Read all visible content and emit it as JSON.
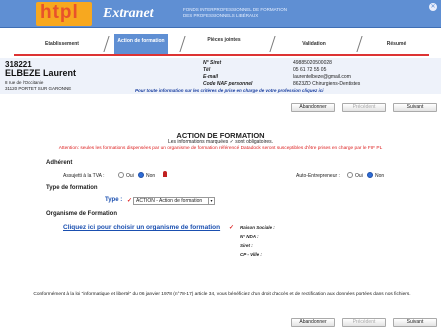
{
  "header": {
    "logo": "htpl",
    "brand": "Extranet",
    "tagline_1": "FONDS INTERPROFESSIONNEL DE FORMATION",
    "tagline_2": "DES PROFESSIONNELS LIBÉRAUX"
  },
  "steps": [
    {
      "label": "Etablissement"
    },
    {
      "label": "Action de formation",
      "active": true
    },
    {
      "label": "Pièces jointes"
    },
    {
      "label": "Validation"
    },
    {
      "label": "Résumé"
    }
  ],
  "establishment": {
    "id": "318221",
    "name": "ELBEZE Laurent",
    "address_1": "8 rue de l'Occitanie",
    "address_2": "31120 PORTET SUR GARONNE",
    "fields": [
      {
        "label": "N° Siret",
        "value": "49885020500028"
      },
      {
        "label": "Tél",
        "value": "05 61 72 55 05"
      },
      {
        "label": "E-mail",
        "value": "laurentelbeze@gmail.com"
      },
      {
        "label": "Code NAF personnel",
        "value": "8623ZD Chirurgiens-Dentistes"
      }
    ],
    "note": "Pour toute information sur les critères de prise en charge de votre profession cliquez ici"
  },
  "nav": {
    "abandon": "Abandonner",
    "previous": "Précédent",
    "next": "Suivant"
  },
  "section": {
    "title": "ACTION DE FORMATION",
    "subtitle": "Les informations marquées ✓ sont obligatoires.",
    "warning": "Attention: seules les formations dispensées par un organisme de formation référencé Datadock seront susceptibles d'être prises en charge par le FIF PL"
  },
  "adherent": {
    "heading": "Adhérent",
    "tva_label": "Assujetti à la TVA :",
    "tva_options": [
      "Oui",
      "Non"
    ],
    "tva_selected": "Non",
    "auto_label": "Auto-Entrepreneur :",
    "auto_options": [
      "Oui",
      "Non"
    ],
    "auto_selected": "Non"
  },
  "type": {
    "heading": "Type de formation",
    "label": "Type :",
    "selected": "ACTION - Action de formation"
  },
  "organisme": {
    "heading": "Organisme de Formation",
    "link": "Cliquez ici pour choisir un organisme de formation",
    "raison": "Raison Sociale :",
    "nda": "N° NDA :",
    "siret": "Siret :",
    "cp": "CP - Ville :"
  },
  "footer": {
    "text": "Conformément à la loi \"informatique et liberté\" du 06 janvier 1978 (n°78-17) article 34, vous bénéficiez d'un droit d'accès et de rectification aux données portées dans nos fichiers."
  }
}
